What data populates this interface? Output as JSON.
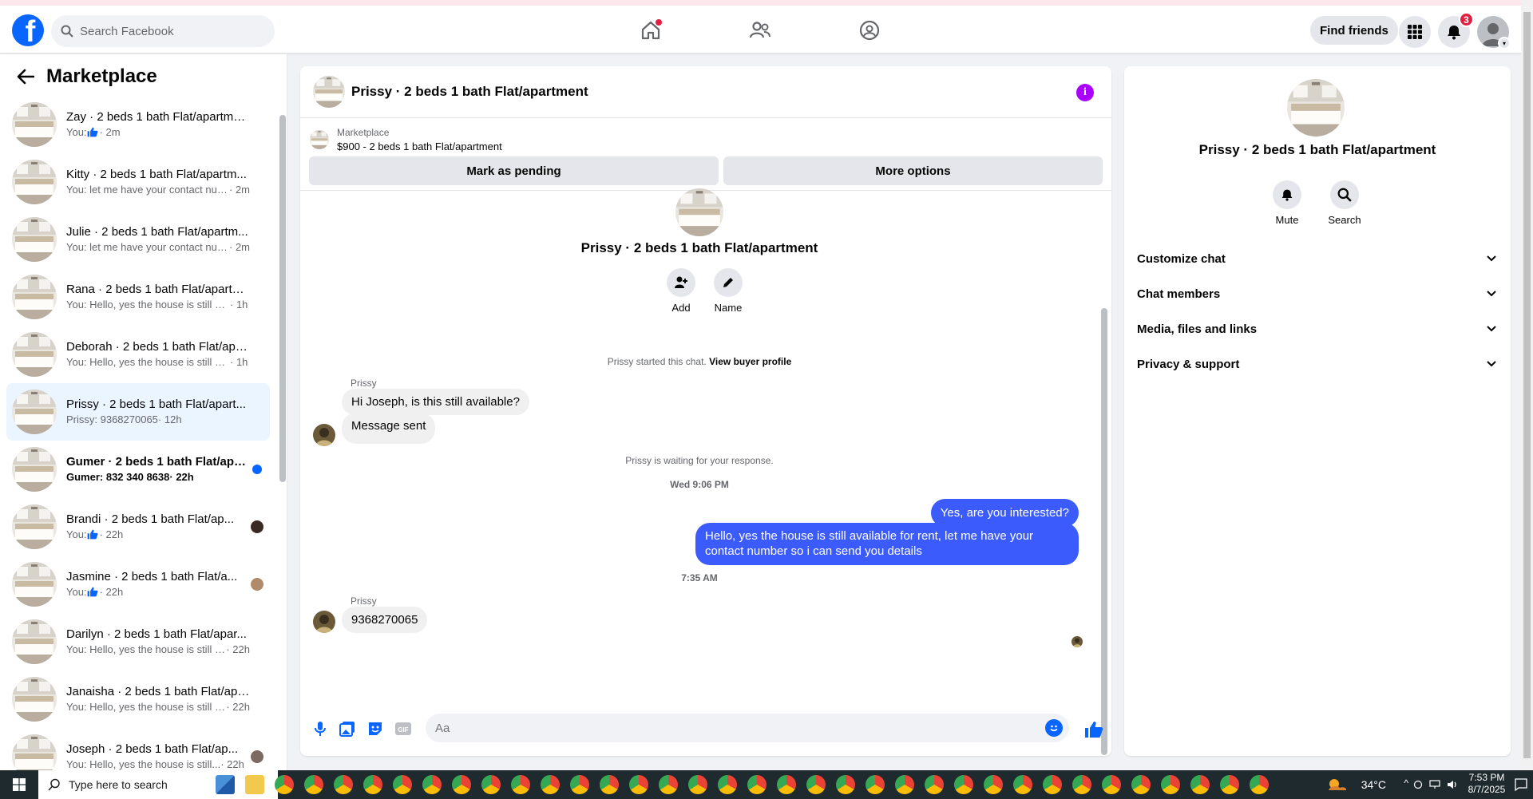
{
  "topbar": {
    "search_placeholder": "Search Facebook",
    "find_friends": "Find friends",
    "notification_count": "3"
  },
  "sidebar": {
    "title": "Marketplace",
    "conversations": [
      {
        "title": "Zay · 2 beds 1 bath Flat/apartment",
        "preview": "You: ",
        "like": true,
        "time": "· 2m",
        "unread": false
      },
      {
        "title": "Kitty · 2 beds 1 bath Flat/apartm...",
        "preview": "You: let me have your contact num...",
        "like": false,
        "time": "· 2m",
        "unread": false
      },
      {
        "title": "Julie · 2 beds 1 bath Flat/apartm...",
        "preview": "You: let me have your contact num...",
        "like": false,
        "time": "· 2m",
        "unread": false
      },
      {
        "title": "Rana · 2 beds 1 bath Flat/apartm...",
        "preview": "You: Hello, yes the house is still avai...",
        "like": false,
        "time": "· 1h",
        "unread": false
      },
      {
        "title": "Deborah · 2 beds 1 bath Flat/apa...",
        "preview": "You: Hello, yes the house is still avai...",
        "like": false,
        "time": "· 1h",
        "unread": false
      },
      {
        "title": "Prissy · 2 beds 1 bath Flat/apart...",
        "preview": "Prissy: 9368270065",
        "like": false,
        "time": "· 12h",
        "unread": false,
        "active": true
      },
      {
        "title": "Gumer · 2 beds 1 bath Flat/apa...",
        "preview": "Gumer: 832 340 8638",
        "like": false,
        "time": "· 22h",
        "unread": true
      },
      {
        "title": "Brandi · 2 beds 1 bath Flat/ap...",
        "preview": "You: ",
        "like": true,
        "time": "· 22h",
        "unread": false
      },
      {
        "title": "Jasmine · 2 beds 1 bath Flat/a...",
        "preview": "You: ",
        "like": true,
        "time": "· 22h",
        "unread": false
      },
      {
        "title": "Darilyn · 2 beds 1 bath Flat/apar...",
        "preview": "You: Hello, yes the house is still av...",
        "like": false,
        "time": "· 22h",
        "unread": false
      },
      {
        "title": "Janaisha · 2 beds 1 bath Flat/apa...",
        "preview": "You: Hello, yes the house is still av...",
        "like": false,
        "time": "· 22h",
        "unread": false
      },
      {
        "title": "Joseph · 2 beds 1 bath Flat/ap...",
        "preview": "You: Hello, yes the house is still...",
        "like": false,
        "time": "· 22h",
        "unread": false
      }
    ]
  },
  "chat": {
    "title": "Prissy · 2 beds 1 bath Flat/apartment",
    "marketplace_label": "Marketplace",
    "listing": "$900 - 2 beds 1 bath Flat/apartment",
    "mark_pending": "Mark as pending",
    "more_options": "More options",
    "intro_title": "Prissy · 2 beds 1 bath Flat/apartment",
    "add_label": "Add",
    "name_label": "Name",
    "started_text": "Prissy started this chat.",
    "view_buyer": "View buyer profile",
    "sender1": "Prissy",
    "msg1": "Hi Joseph, is this still available?",
    "msg2": "Message sent",
    "waiting": "Prissy is waiting for your response.",
    "time1": "Wed 9:06 PM",
    "out1": "Yes, are you interested?",
    "out2": "Hello, yes the house is still available for rent, let me have your contact number so i can send you details",
    "time2": "7:35 AM",
    "sender2": "Prissy",
    "msg3": "9368270065",
    "input_placeholder": "Aa"
  },
  "right_panel": {
    "title": "Prissy · 2 beds 1 bath Flat/apartment",
    "mute": "Mute",
    "search": "Search",
    "sections": [
      "Customize chat",
      "Chat members",
      "Media, files and links",
      "Privacy & support"
    ]
  },
  "taskbar": {
    "search_placeholder": "Type here to search",
    "temperature": "34°C",
    "time": "7:53 PM",
    "date": "8/7/2025"
  },
  "colors": {
    "brand": "#0866ff",
    "outgoing_bubble": "#3b5bfc",
    "active_conversation": "#ebf5ff"
  }
}
